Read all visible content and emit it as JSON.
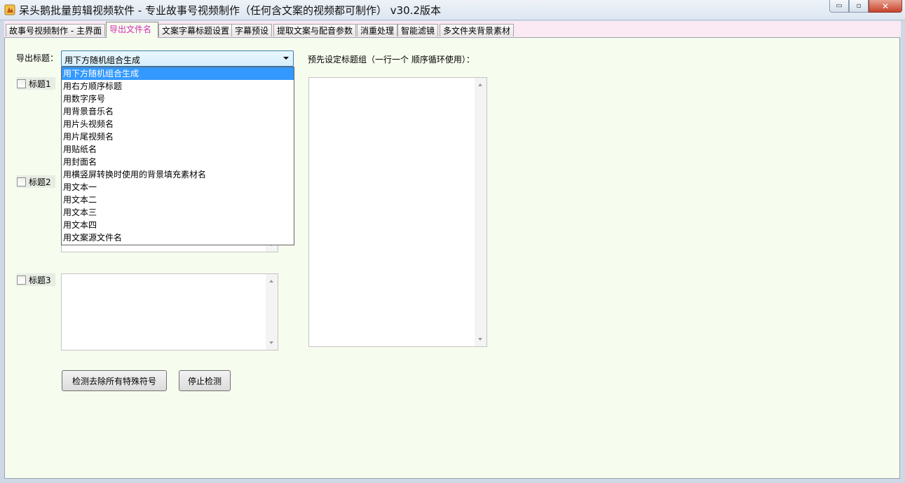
{
  "window": {
    "title": "呆头鹅批量剪辑视频软件 -  专业故事号视频制作（任何含文案的视频都可制作） v30.2版本",
    "minimize": "▭",
    "maximize": "▫",
    "close": "✕"
  },
  "tabs": [
    {
      "label": "故事号视频制作 - 主界面"
    },
    {
      "label": "导出文件名"
    },
    {
      "label": "文案字幕标题设置"
    },
    {
      "label": "字幕预设"
    },
    {
      "label": "提取文案与配音参数"
    },
    {
      "label": "消重处理"
    },
    {
      "label": "智能滤镜"
    },
    {
      "label": "多文件夹背景素材"
    }
  ],
  "export": {
    "label": "导出标题：",
    "combo_value": "用下方随机组合生成",
    "options": [
      "用下方随机组合生成",
      "用右方顺序标题",
      "用数字序号",
      "用背景音乐名",
      "用片头视频名",
      "用片尾视频名",
      "用贴纸名",
      "用封面名",
      "用横竖屏转换时使用的背景填充素材名",
      "用文本一",
      "用文本二",
      "用文本三",
      "用文本四",
      "用文案源文件名"
    ]
  },
  "titles": [
    {
      "label": "标题1"
    },
    {
      "label": "标题2"
    },
    {
      "label": "标题3"
    }
  ],
  "preset": {
    "label": "预先设定标题组（一行一个 顺序循环使用）："
  },
  "buttons": {
    "detect": "检测去除所有特殊符号",
    "stop": "停止检测"
  },
  "colors": {
    "active_tab_text": "#d42fb8",
    "panel_bg": "#f6fcee",
    "selection": "#3399ff"
  }
}
